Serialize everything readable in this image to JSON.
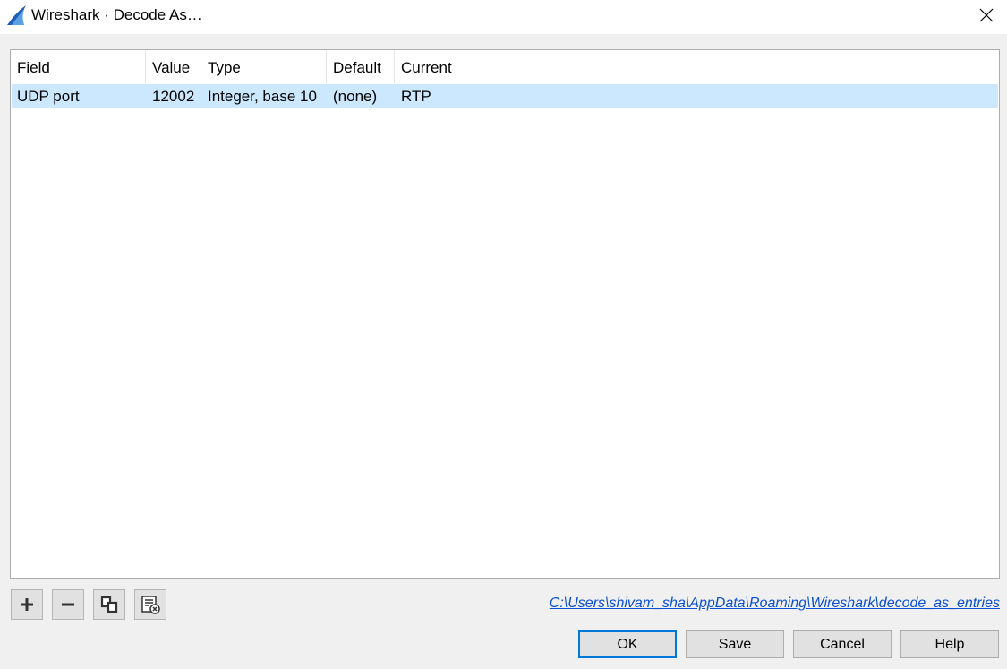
{
  "window": {
    "title": "Wireshark · Decode As…"
  },
  "table": {
    "headers": [
      "Field",
      "Value",
      "Type",
      "Default",
      "Current"
    ],
    "rows": [
      [
        "UDP port",
        "12002",
        "Integer, base 10",
        "(none)",
        "RTP"
      ]
    ]
  },
  "toolbar": {
    "icons": [
      "plus-icon",
      "minus-icon",
      "copy-icon",
      "clear-list-icon"
    ]
  },
  "footer": {
    "path": "C:\\Users\\shivam_sha\\AppData\\Roaming\\Wireshark\\decode_as_entries"
  },
  "buttons": {
    "ok": "OK",
    "save": "Save",
    "cancel": "Cancel",
    "help": "Help"
  },
  "colors": {
    "selection": "#cce8ff",
    "link": "#0a4fd4",
    "accent": "#0078d7",
    "shark_fin": "#1f5fb3"
  }
}
